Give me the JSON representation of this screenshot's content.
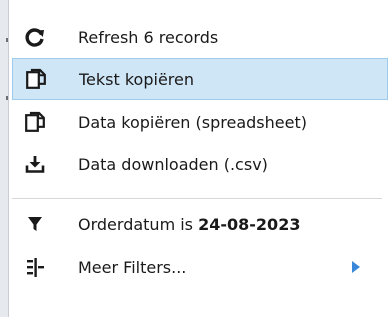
{
  "menu": {
    "items": [
      {
        "id": "refresh",
        "label": "Refresh 6 records",
        "icon": "refresh-icon"
      },
      {
        "id": "copy-text",
        "label": "Tekst kopiëren",
        "icon": "copy-icon",
        "selected": true
      },
      {
        "id": "copy-data",
        "label": "Data kopiëren (spreadsheet)",
        "icon": "copy-icon"
      },
      {
        "id": "download-csv",
        "label": "Data downloaden (.csv)",
        "icon": "download-icon"
      },
      {
        "id": "filter-date",
        "label_prefix": "Orderdatum is ",
        "label_value": "24-08-2023",
        "icon": "filter-icon"
      },
      {
        "id": "more-filters",
        "label": "Meer Filters...",
        "icon": "filter-settings-icon",
        "submenu_icon": "submenu-arrow-icon"
      }
    ]
  },
  "colors": {
    "selected_background": "#cfe6f7",
    "selected_border": "#9ccbee",
    "submenu_arrow": "#3a86d8"
  }
}
